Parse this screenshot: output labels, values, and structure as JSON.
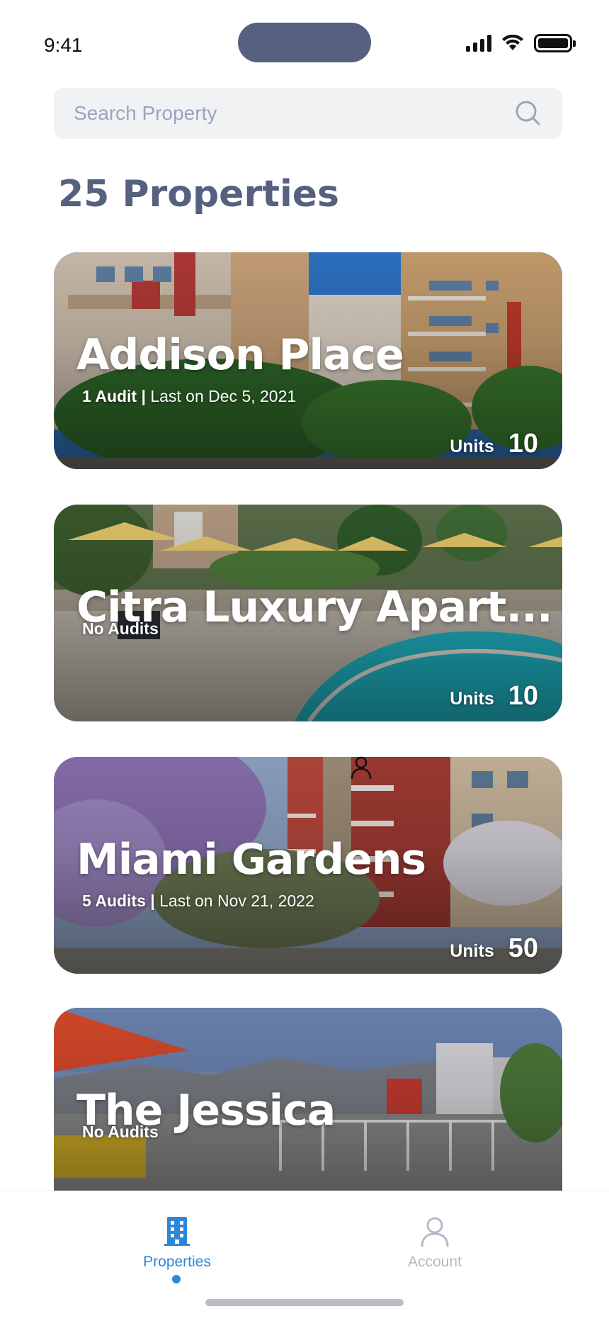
{
  "status_bar": {
    "time": "9:41"
  },
  "search": {
    "placeholder": "Search Property"
  },
  "page_title": "25 Properties",
  "properties": [
    {
      "name": "Addison Place",
      "audits": "1 Audit",
      "separator": "|",
      "last": "Last on Dec 5, 2021",
      "units_label": "Units",
      "units": "10"
    },
    {
      "name": "Citra Luxury Apart...",
      "audits": "No Audits",
      "separator": "",
      "last": "",
      "units_label": "Units",
      "units": "10"
    },
    {
      "name": "Miami Gardens",
      "audits": "5 Audits",
      "separator": "|",
      "last": "Last on Nov 21, 2022",
      "units_label": "Units",
      "units": "50"
    },
    {
      "name": "The Jessica",
      "audits": "No Audits",
      "separator": "",
      "last": "",
      "units_label": "",
      "units": ""
    }
  ],
  "tabbar": {
    "properties_label": "Properties",
    "account_label": "Account"
  },
  "colors": {
    "accent": "#2e86d6",
    "title": "#56607f",
    "inactive": "#b3bac8"
  }
}
